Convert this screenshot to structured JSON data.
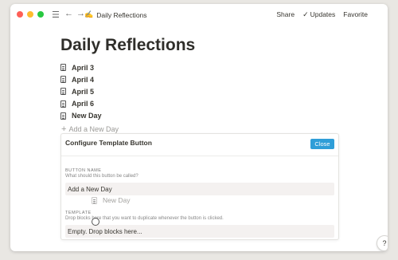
{
  "window": {
    "traffic_lights": [
      {
        "name": "close",
        "color": "#fe5f57"
      },
      {
        "name": "minimize",
        "color": "#febc2e"
      },
      {
        "name": "maximize",
        "color": "#28c840"
      }
    ]
  },
  "topbar": {
    "breadcrumb_emoji": "✍️",
    "breadcrumb_title": "Daily Reflections",
    "share": "Share",
    "updates": "Updates",
    "favorite": "Favorite"
  },
  "page": {
    "title": "Daily Reflections",
    "items": [
      "April 3",
      "April 4",
      "April 5",
      "April 6",
      "New Day"
    ],
    "add_button": "Add a New Day"
  },
  "config": {
    "title": "Configure Template Button",
    "close_label": "Close",
    "button_name_label": "BUTTON NAME",
    "button_name_hint": "What should this button be called?",
    "button_name_value": "Add a New Day",
    "template_label": "TEMPLATE",
    "template_hint": "Drop blocks here that you want to duplicate whenever the button is clicked.",
    "template_placeholder": "Empty. Drop blocks here..."
  },
  "drag_ghost": "New Day",
  "help": "?",
  "colors": {
    "close_button": "#2f9ed8",
    "field_bg": "#f4f1f0"
  }
}
